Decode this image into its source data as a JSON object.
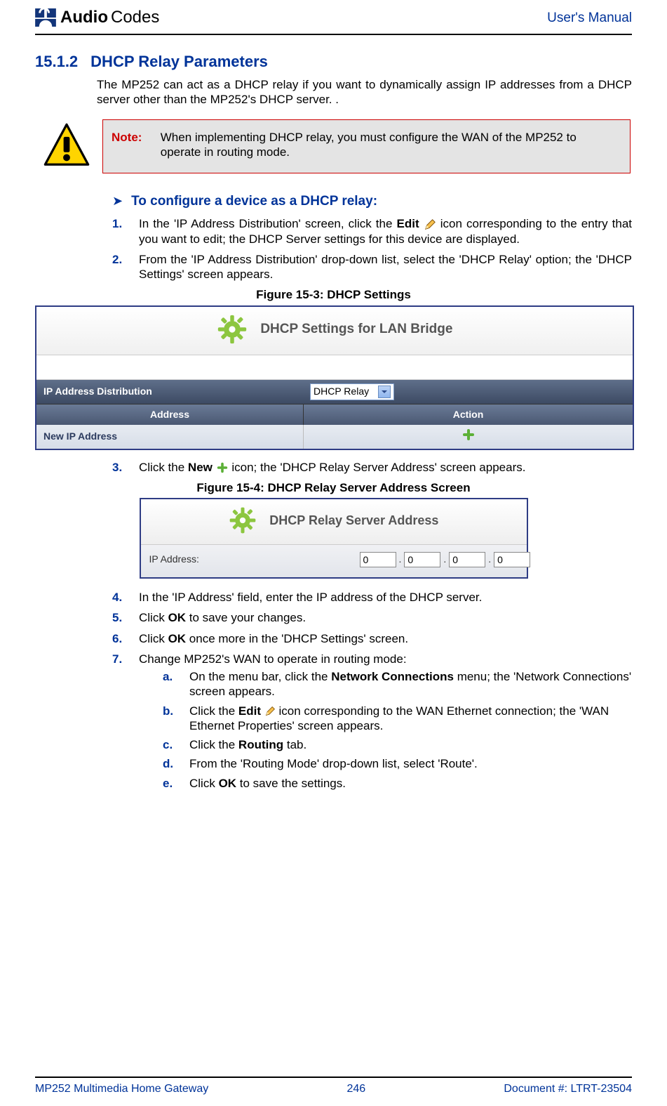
{
  "brand": {
    "name1": "Audio",
    "name2": "Codes"
  },
  "header": {
    "right": "User's Manual"
  },
  "section": {
    "number": "15.1.2",
    "title": "DHCP Relay Parameters"
  },
  "intro": "The MP252 can act as a DHCP relay if you want to dynamically assign IP addresses from a DHCP server other than the MP252's DHCP server. .",
  "note": {
    "label": "Note:",
    "body": "When implementing DHCP relay, you must configure the WAN of the MP252 to operate in routing mode."
  },
  "procedure_title": "To configure a device as a DHCP relay:",
  "steps": {
    "1": {
      "pre": "In the 'IP Address Distribution' screen, click the ",
      "bold": "Edit",
      "post": " icon corresponding to the entry that you want to edit; the DHCP Server settings for this device are displayed."
    },
    "2": "From the 'IP Address Distribution' drop-down list, select the 'DHCP Relay' option; the 'DHCP Settings' screen appears.",
    "3": {
      "pre": "Click the ",
      "bold": "New",
      "post": " icon; the 'DHCP Relay Server Address' screen appears."
    },
    "4": "In the 'IP Address' field, enter the IP address of the DHCP server.",
    "5": {
      "pre": "Click ",
      "bold": "OK",
      "post": " to save your changes."
    },
    "6": {
      "pre": "Click ",
      "bold": "OK",
      "post": " once more in the 'DHCP Settings' screen."
    },
    "7": "Change MP252's WAN to operate in routing mode:"
  },
  "substeps": {
    "a": {
      "pre": "On the menu bar, click the ",
      "bold": "Network Connections",
      "post": " menu; the 'Network Connections' screen appears."
    },
    "b": {
      "pre": "Click the ",
      "bold": "Edit",
      "post": " icon corresponding to the WAN Ethernet connection; the 'WAN Ethernet Properties' screen appears."
    },
    "c": {
      "pre": "Click the ",
      "bold": "Routing",
      "post": " tab."
    },
    "d": "From the 'Routing Mode' drop-down list, select 'Route'.",
    "e": {
      "pre": "Click ",
      "bold": "OK",
      "post": " to save the settings."
    }
  },
  "figures": {
    "f1": {
      "caption": "Figure 15-3: DHCP Settings",
      "title": "DHCP Settings for LAN Bridge",
      "row_label": "IP Address Distribution",
      "dropdown_value": "DHCP Relay",
      "col1": "Address",
      "col2": "Action",
      "new_row_label": "New IP Address"
    },
    "f2": {
      "caption": "Figure 15-4: DHCP Relay Server Address Screen",
      "title": "DHCP Relay Server Address",
      "label": "IP Address:",
      "ip": {
        "o1": "0",
        "o2": "0",
        "o3": "0",
        "o4": "0"
      }
    }
  },
  "footer": {
    "left": "MP252 Multimedia Home Gateway",
    "center": "246",
    "right": "Document #: LTRT-23504"
  }
}
